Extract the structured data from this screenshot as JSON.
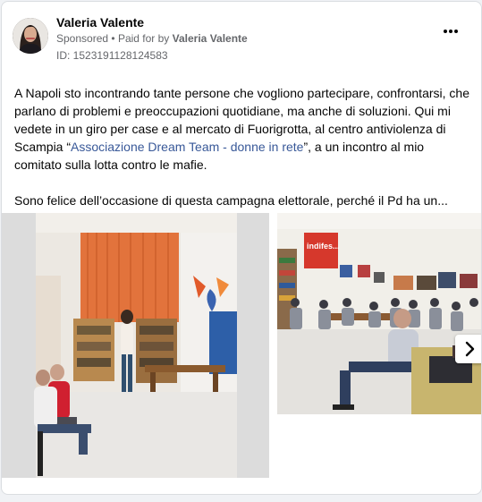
{
  "post": {
    "author": "Valeria Valente",
    "sponsored": "Sponsored",
    "separator": "•",
    "paid_prefix": "Paid for by",
    "paid_by": "Valeria Valente",
    "ad_id": "ID: 1523191128124583",
    "more_icon": "more-horizontal-icon",
    "text": {
      "p1_before": "A Napoli sto incontrando tante persone che vogliono partecipare, confrontarsi, che parlano di problemi e preoccupazioni quotidiane, ma anche di soluzioni. Qui mi vedete in un giro per case e al mercato di Fuorigrotta, al centro antiviolenza di Scampia “",
      "p1_link": "Associazione Dream Team - donne in rete",
      "p1_after": "”, a un incontro al mio comitato sulla lotta contro le mafie.",
      "p2": "Sono felice dell’occasione di questa campagna elettorale, perché il Pd ha un..."
    }
  },
  "carousel": {
    "next_icon": "chevron-right-icon",
    "slide2_sign": "indifes..."
  },
  "colors": {
    "link": "#385898",
    "muted": "#65676b",
    "text": "#050505"
  }
}
